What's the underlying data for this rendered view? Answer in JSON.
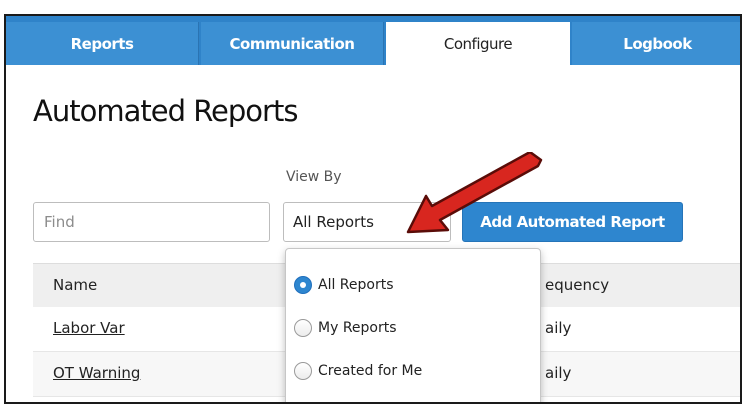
{
  "tabs": [
    {
      "label": "Reports",
      "active": false
    },
    {
      "label": "Communication",
      "active": false
    },
    {
      "label": "Configure",
      "active": true
    },
    {
      "label": "Logbook",
      "active": false
    }
  ],
  "page_title": "Automated Reports",
  "filters": {
    "view_by_label": "View By",
    "find_placeholder": "Find",
    "view_by_selected": "All Reports",
    "add_button_label": "Add Automated Report"
  },
  "dropdown": {
    "options": [
      {
        "label": "All Reports",
        "selected": true
      },
      {
        "label": "My Reports",
        "selected": false
      },
      {
        "label": "Created for Me",
        "selected": false
      }
    ]
  },
  "table": {
    "headers": {
      "name": "Name",
      "frequency": "equency"
    },
    "rows": [
      {
        "name": "Labor Var",
        "frequency": "aily"
      },
      {
        "name": "OT Warning",
        "frequency": "aily"
      }
    ]
  },
  "annotation": {
    "arrow_color": "#d8261f",
    "icon": "red-pointer-arrow"
  },
  "colors": {
    "tab_bar": "#2f83c9",
    "accent_button": "#2e86cf"
  }
}
